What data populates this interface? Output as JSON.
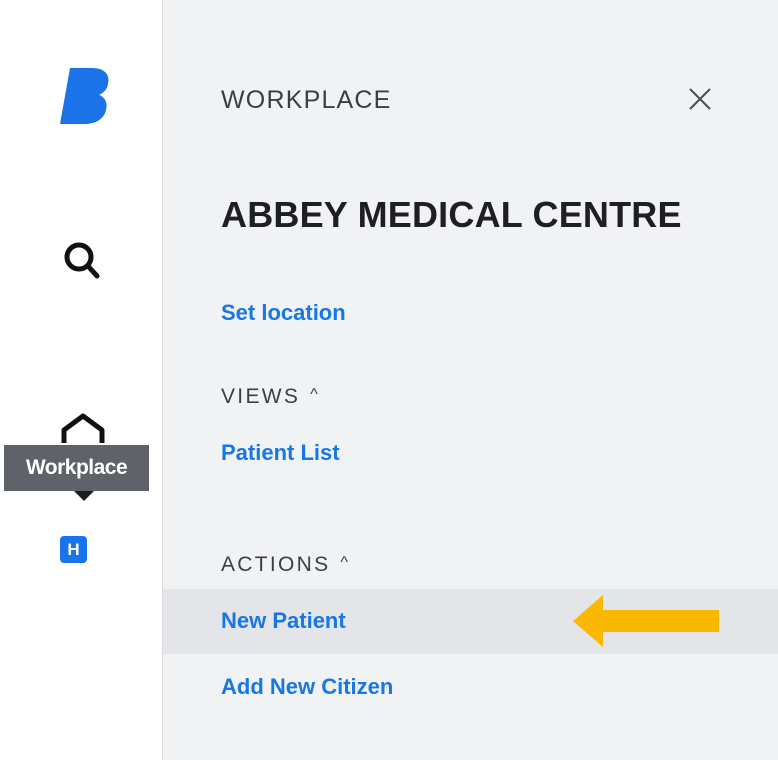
{
  "rail": {
    "logo_icon": "brand-b-icon",
    "search_icon": "search-icon",
    "home_icon": "home-icon",
    "tooltip": "Workplace",
    "workplace_badge": "H"
  },
  "panel": {
    "heading": "WORKPLACE",
    "close_icon": "close-icon",
    "location_name": "ABBEY MEDICAL CENTRE",
    "set_location": "Set location",
    "views_label": "VIEWS",
    "views_items": [
      "Patient List"
    ],
    "actions_label": "ACTIONS",
    "actions_items": [
      "New Patient",
      "Add New Citizen"
    ],
    "caret": "^"
  },
  "colors": {
    "link": "#1877e6",
    "brand": "#1a73e8",
    "panel_bg": "#f1f2f4",
    "highlight": "#e4e5e8",
    "annotation_arrow": "#fbb800"
  }
}
